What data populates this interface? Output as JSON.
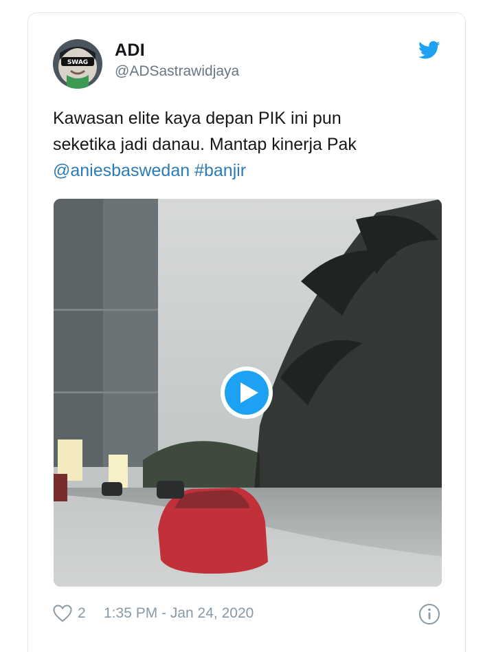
{
  "tweet": {
    "author_name": "ADI",
    "author_handle": "@ADSastrawidjaya",
    "text_line_1": "Kawasan elite kaya depan PIK ini pun",
    "text_line_2": "seketika jadi danau. Mantap kinerja Pak",
    "mention": "@aniesbaswedan",
    "hashtag": "#banjir",
    "avatar_caption": "SWAG",
    "like_count": "2",
    "timestamp": "1:35 PM - Jan 24, 2020"
  },
  "icons": {
    "brand": "twitter-bird-icon",
    "media_action": "play-icon",
    "like": "heart-icon",
    "info": "info-icon"
  },
  "colors": {
    "link": "#2b7bb9",
    "twitter_blue": "#1da1f2",
    "text": "#14171a",
    "muted": "#8899a6",
    "border": "#dfe5ea"
  }
}
